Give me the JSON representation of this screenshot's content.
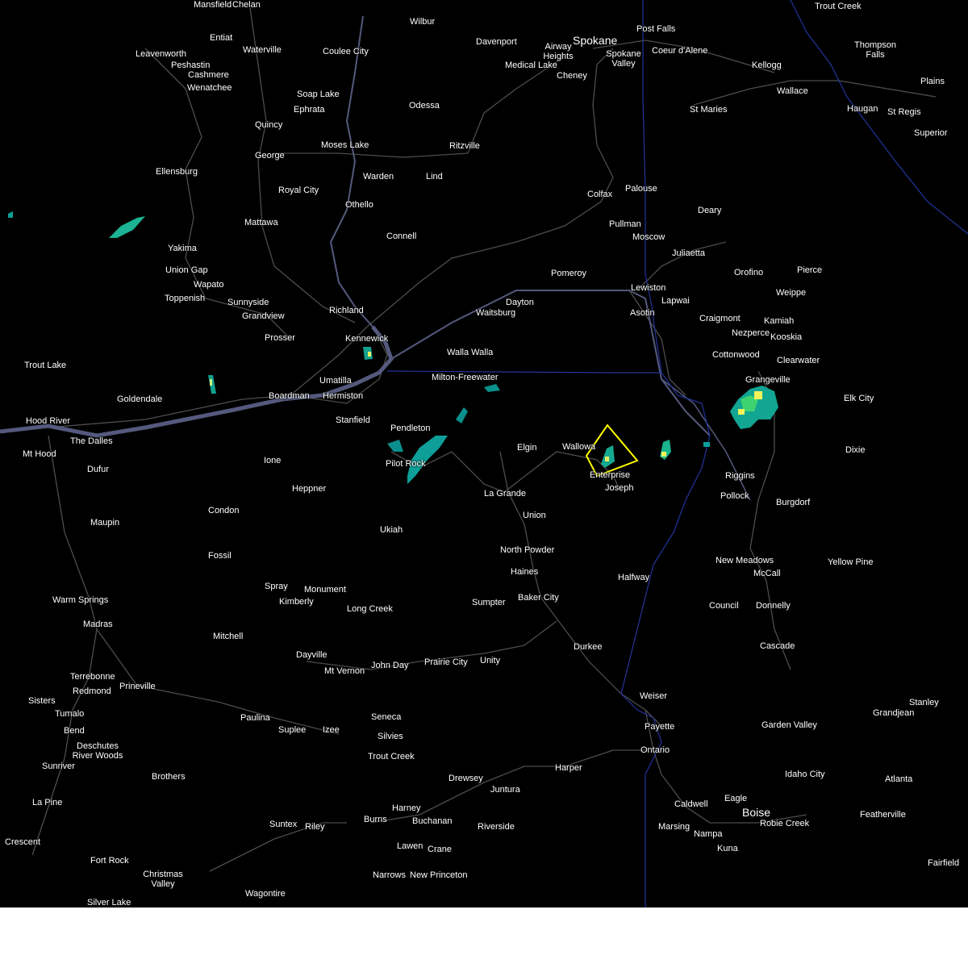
{
  "map": {
    "colors": {
      "background": "#000000",
      "roads": "#555555",
      "state_border": "#1f2f9a",
      "river": "#4a4f7a",
      "radar_low": "#0aa7a0",
      "radar_mid": "#1fd47b",
      "radar_high": "#f4f45a",
      "warning_polygon": "#ffff00"
    },
    "places": [
      {
        "name": "Mansfield"
      },
      {
        "name": "Chelan"
      },
      {
        "name": "Wilbur"
      },
      {
        "name": "Trout Creek"
      },
      {
        "name": "Spokane"
      },
      {
        "name": "Post Falls"
      },
      {
        "name": "Davenport"
      },
      {
        "name": "Airway Heights"
      },
      {
        "name": "Spokane Valley"
      },
      {
        "name": "Coeur d'Alene"
      },
      {
        "name": "Thompson Falls"
      },
      {
        "name": "Entiat"
      },
      {
        "name": "Waterville"
      },
      {
        "name": "Coulee City"
      },
      {
        "name": "Medical Lake"
      },
      {
        "name": "Leavenworth"
      },
      {
        "name": "Peshastin"
      },
      {
        "name": "Cashmere"
      },
      {
        "name": "Cheney"
      },
      {
        "name": "Kellogg"
      },
      {
        "name": "Plains"
      },
      {
        "name": "Wenatchee"
      },
      {
        "name": "Wallace"
      },
      {
        "name": "Soap Lake"
      },
      {
        "name": "Ephrata"
      },
      {
        "name": "Odessa"
      },
      {
        "name": "St Maries"
      },
      {
        "name": "Haugan"
      },
      {
        "name": "St Regis"
      },
      {
        "name": "Quincy"
      },
      {
        "name": "Superior"
      },
      {
        "name": "Moses Lake"
      },
      {
        "name": "Ritzville"
      },
      {
        "name": "George"
      },
      {
        "name": "Ellensburg"
      },
      {
        "name": "Warden"
      },
      {
        "name": "Lind"
      },
      {
        "name": "Royal City"
      },
      {
        "name": "Colfax"
      },
      {
        "name": "Palouse"
      },
      {
        "name": "Othello"
      },
      {
        "name": "Deary"
      },
      {
        "name": "Mattawa"
      },
      {
        "name": "Pullman"
      },
      {
        "name": "Connell"
      },
      {
        "name": "Moscow"
      },
      {
        "name": "Yakima"
      },
      {
        "name": "Juliaetta"
      },
      {
        "name": "Union Gap"
      },
      {
        "name": "Orofino"
      },
      {
        "name": "Pierce"
      },
      {
        "name": "Pomeroy"
      },
      {
        "name": "Wapato"
      },
      {
        "name": "Lewiston"
      },
      {
        "name": "Weippe"
      },
      {
        "name": "Toppenish"
      },
      {
        "name": "Sunnyside"
      },
      {
        "name": "Lapwai"
      },
      {
        "name": "Dayton"
      },
      {
        "name": "Richland"
      },
      {
        "name": "Grandview"
      },
      {
        "name": "Waitsburg"
      },
      {
        "name": "Asotin"
      },
      {
        "name": "Craigmont"
      },
      {
        "name": "Kamiah"
      },
      {
        "name": "Prosser"
      },
      {
        "name": "Nezperce"
      },
      {
        "name": "Kennewick"
      },
      {
        "name": "Kooskia"
      },
      {
        "name": "Walla Walla"
      },
      {
        "name": "Cottonwood"
      },
      {
        "name": "Trout Lake"
      },
      {
        "name": "Clearwater"
      },
      {
        "name": "Umatilla"
      },
      {
        "name": "Milton-Freewater"
      },
      {
        "name": "Grangeville"
      },
      {
        "name": "Boardman"
      },
      {
        "name": "Hermiston"
      },
      {
        "name": "Goldendale"
      },
      {
        "name": "Elk City"
      },
      {
        "name": "Hood River"
      },
      {
        "name": "Stanfield"
      },
      {
        "name": "Pendleton"
      },
      {
        "name": "The Dalles"
      },
      {
        "name": "Elgin"
      },
      {
        "name": "Wallowa"
      },
      {
        "name": "Mt Hood"
      },
      {
        "name": "Dixie"
      },
      {
        "name": "Pilot Rock"
      },
      {
        "name": "Ione"
      },
      {
        "name": "Dufur"
      },
      {
        "name": "Enterprise"
      },
      {
        "name": "Riggins"
      },
      {
        "name": "Joseph"
      },
      {
        "name": "Heppner"
      },
      {
        "name": "La Grande"
      },
      {
        "name": "Pollock"
      },
      {
        "name": "Burgdorf"
      },
      {
        "name": "Condon"
      },
      {
        "name": "Union"
      },
      {
        "name": "Maupin"
      },
      {
        "name": "Ukiah"
      },
      {
        "name": "North Powder"
      },
      {
        "name": "Fossil"
      },
      {
        "name": "New Meadows"
      },
      {
        "name": "Yellow Pine"
      },
      {
        "name": "Haines"
      },
      {
        "name": "McCall"
      },
      {
        "name": "Halfway"
      },
      {
        "name": "Spray"
      },
      {
        "name": "Monument"
      },
      {
        "name": "Baker City"
      },
      {
        "name": "Kimberly"
      },
      {
        "name": "Warm Springs"
      },
      {
        "name": "Sumpter"
      },
      {
        "name": "Council"
      },
      {
        "name": "Donnelly"
      },
      {
        "name": "Long Creek"
      },
      {
        "name": "Madras"
      },
      {
        "name": "Mitchell"
      },
      {
        "name": "Cascade"
      },
      {
        "name": "Durkee"
      },
      {
        "name": "Dayville"
      },
      {
        "name": "Unity"
      },
      {
        "name": "Prairie City"
      },
      {
        "name": "Mt Vernon"
      },
      {
        "name": "John Day"
      },
      {
        "name": "Terrebonne"
      },
      {
        "name": "Prineville"
      },
      {
        "name": "Redmond"
      },
      {
        "name": "Weiser"
      },
      {
        "name": "Sisters"
      },
      {
        "name": "Stanley"
      },
      {
        "name": "Tumalo"
      },
      {
        "name": "Grandjean"
      },
      {
        "name": "Paulina"
      },
      {
        "name": "Seneca"
      },
      {
        "name": "Bend"
      },
      {
        "name": "Suplee"
      },
      {
        "name": "Izee"
      },
      {
        "name": "Payette"
      },
      {
        "name": "Garden Valley"
      },
      {
        "name": "Silvies"
      },
      {
        "name": "Deschutes River Woods"
      },
      {
        "name": "Ontario"
      },
      {
        "name": "Trout Creek"
      },
      {
        "name": "Sunriver"
      },
      {
        "name": "Harper"
      },
      {
        "name": "Idaho City"
      },
      {
        "name": "Brothers"
      },
      {
        "name": "Drewsey"
      },
      {
        "name": "Atlanta"
      },
      {
        "name": "Juntura"
      },
      {
        "name": "La Pine"
      },
      {
        "name": "Eagle"
      },
      {
        "name": "Caldwell"
      },
      {
        "name": "Suntex"
      },
      {
        "name": "Riley"
      },
      {
        "name": "Harney"
      },
      {
        "name": "Burns"
      },
      {
        "name": "Buchanan"
      },
      {
        "name": "Boise"
      },
      {
        "name": "Featherville"
      },
      {
        "name": "Riverside"
      },
      {
        "name": "Robie Creek"
      },
      {
        "name": "Marsing"
      },
      {
        "name": "Nampa"
      },
      {
        "name": "Crescent"
      },
      {
        "name": "Lawen"
      },
      {
        "name": "Crane"
      },
      {
        "name": "Kuna"
      },
      {
        "name": "Fort Rock"
      },
      {
        "name": "Fairfield"
      },
      {
        "name": "Narrows"
      },
      {
        "name": "New Princeton"
      },
      {
        "name": "Christmas Valley"
      },
      {
        "name": "Wagontire"
      },
      {
        "name": "Silver Lake"
      }
    ]
  }
}
